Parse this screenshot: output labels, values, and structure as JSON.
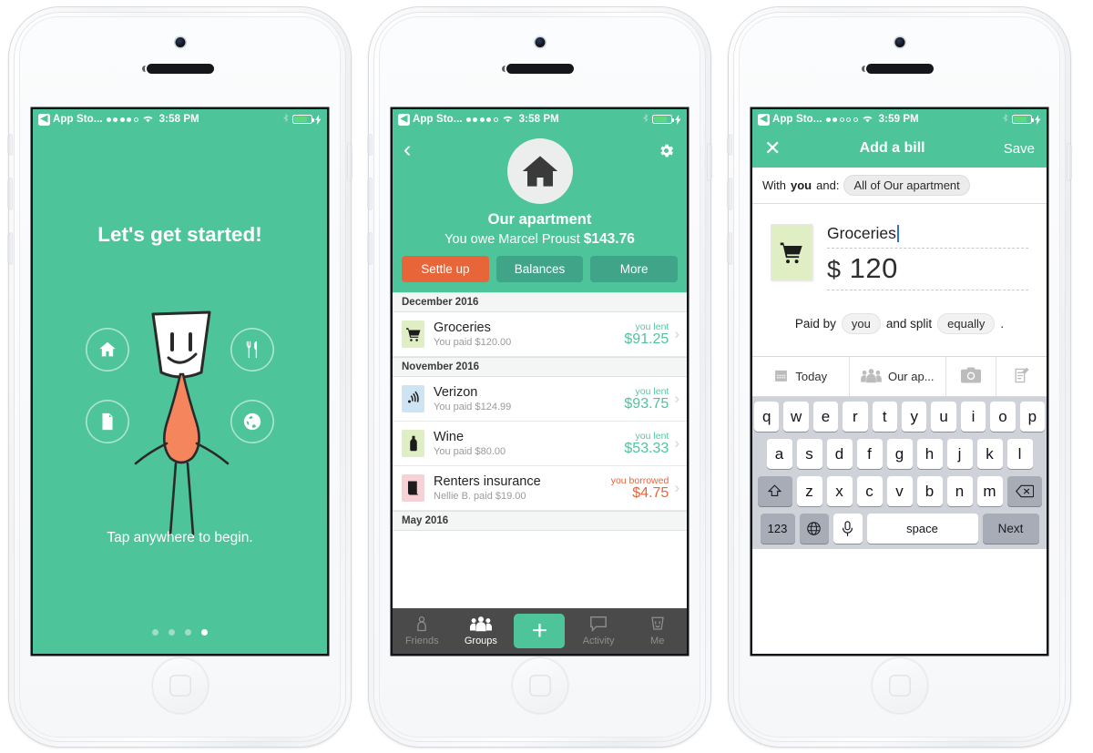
{
  "phone1": {
    "status": {
      "back_label": "App Sto...",
      "signal_filled": 4,
      "signal_total": 5,
      "time": "3:58 PM"
    },
    "welcome": {
      "heading": "Let's get started!",
      "tap_text": "Tap anywhere to begin.",
      "icons": [
        "home-icon",
        "utensils-icon",
        "document-icon",
        "globe-icon"
      ],
      "page_dots": 4,
      "active_dot": 4
    }
  },
  "phone2": {
    "status": {
      "back_label": "App Sto...",
      "signal_filled": 4,
      "signal_total": 5,
      "time": "3:58 PM"
    },
    "header": {
      "back_icon": "chevron-left-icon",
      "settings_icon": "gear-icon",
      "avatar_icon": "house-icon",
      "group_name": "Our apartment",
      "balance_prefix": "You owe Marcel Proust",
      "balance_amount": "$143.76",
      "buttons": [
        {
          "label": "Settle up",
          "style": "primary"
        },
        {
          "label": "Balances",
          "style": "default"
        },
        {
          "label": "More",
          "style": "default"
        }
      ]
    },
    "sections": [
      {
        "month": "December 2016",
        "expenses": [
          {
            "icon": "shopping-cart-icon",
            "icon_bg": "#e0eec3",
            "title": "Groceries",
            "sub": "You paid $120.00",
            "direction": "you lent",
            "amount": "$91.25",
            "kind": "lent"
          }
        ]
      },
      {
        "month": "November 2016",
        "expenses": [
          {
            "icon": "signal-icon",
            "icon_bg": "#cfe4f2",
            "title": "Verizon",
            "sub": "You paid $124.99",
            "direction": "you lent",
            "amount": "$93.75",
            "kind": "lent"
          },
          {
            "icon": "wine-bottle-icon",
            "icon_bg": "#e0eec3",
            "title": "Wine",
            "sub": "You paid $80.00",
            "direction": "you lent",
            "amount": "$53.33",
            "kind": "lent"
          },
          {
            "icon": "contract-icon",
            "icon_bg": "#f6d2d6",
            "title": "Renters insurance",
            "sub": "Nellie B. paid $19.00",
            "direction": "you borrowed",
            "amount": "$4.75",
            "kind": "borrowed"
          }
        ]
      },
      {
        "month": "May 2016",
        "expenses": []
      }
    ],
    "tabbar": [
      {
        "icon": "person-icon",
        "label": "Friends",
        "active": false
      },
      {
        "icon": "group-icon",
        "label": "Groups",
        "active": true
      },
      {
        "icon": "plus-icon",
        "label": "",
        "active": false,
        "is_plus": true
      },
      {
        "icon": "speech-bubble-icon",
        "label": "Activity",
        "active": false
      },
      {
        "icon": "mascot-icon",
        "label": "Me",
        "active": false
      }
    ]
  },
  "phone3": {
    "status": {
      "back_label": "App Sto...",
      "signal_filled": 2,
      "signal_total": 5,
      "time": "3:59 PM"
    },
    "nav": {
      "close_icon": "close-icon",
      "title": "Add a bill",
      "save_label": "Save"
    },
    "with_row": {
      "prefix": "With",
      "you": "you",
      "and": "and:",
      "group_pill": "All of Our apartment"
    },
    "form": {
      "thumb_icon": "shopping-cart-icon",
      "description": "Groceries",
      "currency": "$",
      "amount": "120",
      "paid_prefix": "Paid by",
      "payer_pill": "you",
      "split_prefix": "and split",
      "split_pill": "equally",
      "suffix": "."
    },
    "tools": [
      {
        "icon": "calendar-icon",
        "label": "Today"
      },
      {
        "icon": "group-icon",
        "label": "Our ap..."
      },
      {
        "icon": "camera-icon",
        "label": ""
      },
      {
        "icon": "notes-icon",
        "label": ""
      }
    ],
    "keyboard": {
      "row1": [
        "q",
        "w",
        "e",
        "r",
        "t",
        "y",
        "u",
        "i",
        "o",
        "p"
      ],
      "row2": [
        "a",
        "s",
        "d",
        "f",
        "g",
        "h",
        "j",
        "k",
        "l"
      ],
      "row3": [
        "z",
        "x",
        "c",
        "v",
        "b",
        "n",
        "m"
      ],
      "shift_icon": "shift-icon",
      "backspace_icon": "backspace-icon",
      "numbers_label": "123",
      "globe_icon": "globe-icon",
      "mic_icon": "microphone-icon",
      "space_label": "space",
      "next_label": "Next"
    }
  },
  "colors": {
    "brand_green": "#4ec49b",
    "accent_orange": "#e8653a",
    "dark_green_btn": "#3fa488",
    "lent_green": "#5bc5a7",
    "tabbar_dark": "#4a4a4a"
  }
}
